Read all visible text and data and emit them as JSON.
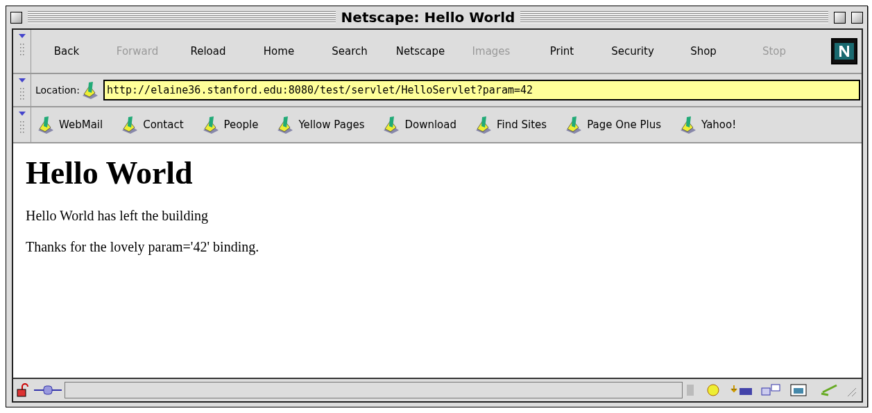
{
  "window": {
    "title": "Netscape: Hello World"
  },
  "toolbar": [
    {
      "label": "Back",
      "disabled": false
    },
    {
      "label": "Forward",
      "disabled": true
    },
    {
      "label": "Reload",
      "disabled": false
    },
    {
      "label": "Home",
      "disabled": false
    },
    {
      "label": "Search",
      "disabled": false
    },
    {
      "label": "Netscape",
      "disabled": false
    },
    {
      "label": "Images",
      "disabled": true
    },
    {
      "label": "Print",
      "disabled": false
    },
    {
      "label": "Security",
      "disabled": false
    },
    {
      "label": "Shop",
      "disabled": false
    },
    {
      "label": "Stop",
      "disabled": true
    }
  ],
  "location": {
    "label": "Location:",
    "value": "http://elaine36.stanford.edu:8080/test/servlet/HelloServlet?param=42"
  },
  "bookmarks": [
    "WebMail",
    "Contact",
    "People",
    "Yellow Pages",
    "Download",
    "Find Sites",
    "Page One Plus",
    "Yahoo!"
  ],
  "page": {
    "heading": "Hello World",
    "paragraphs": [
      "Hello World has left the building",
      "Thanks for the lovely param='42' binding."
    ]
  }
}
